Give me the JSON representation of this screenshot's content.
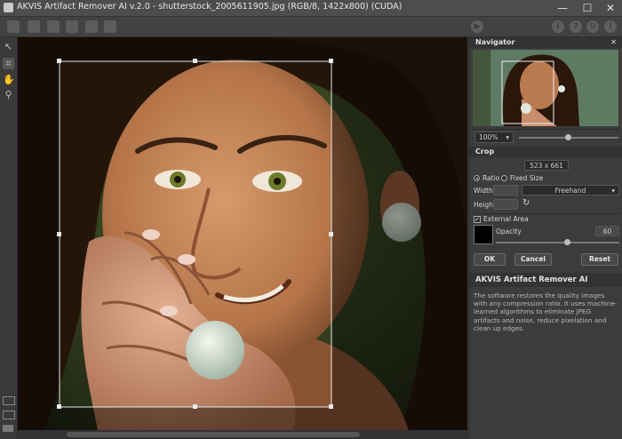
{
  "window": {
    "title": "AKVIS Artifact Remover AI v.2.0 - shutterstock_2005611905.jpg (RGB/8, 1422x800) (CUDA)",
    "minimize": "—",
    "maximize": "☐",
    "close": "✕"
  },
  "navigator": {
    "title": "Navigator",
    "close_glyph": "✕",
    "zoom_value": "100%",
    "zoom_arrow": "▾"
  },
  "crop": {
    "title": "Crop",
    "dimensions": "523 x 661",
    "ratio_label": "Ratio",
    "fixed_size_label": "Fixed Size",
    "mode": "ratio",
    "width_label": "Width",
    "width_value": "",
    "height_label": "Height",
    "height_value": "",
    "freehand_value": "Freehand",
    "freehand_arrow": "▾",
    "rotate_glyph": "↻",
    "external_area_label": "External Area",
    "external_area_checked": true,
    "opacity_label": "Opacity",
    "opacity_value": "60",
    "swatch_color": "#000000",
    "ok_label": "OK",
    "cancel_label": "Cancel",
    "reset_label": "Reset"
  },
  "about": {
    "title": "AKVIS Artifact Remover AI",
    "description": "The software restores the quality images with any compression ratio. It uses machine-learned algorithms to eliminate JPEG artifacts and noise, reduce pixelation and clean up edges."
  },
  "toolbar": {
    "info_glyph": "i",
    "help_glyph": "?",
    "settings_glyph": "⚙",
    "bug_glyph": "!"
  },
  "tools": {
    "crop_glyph": "⌗",
    "hand_glyph": "✋",
    "zoom_glyph": "⚲",
    "pointer_glyph": "↖"
  },
  "colors": {
    "panel_bg": "#3c3c3c",
    "header_bg": "#333333"
  }
}
